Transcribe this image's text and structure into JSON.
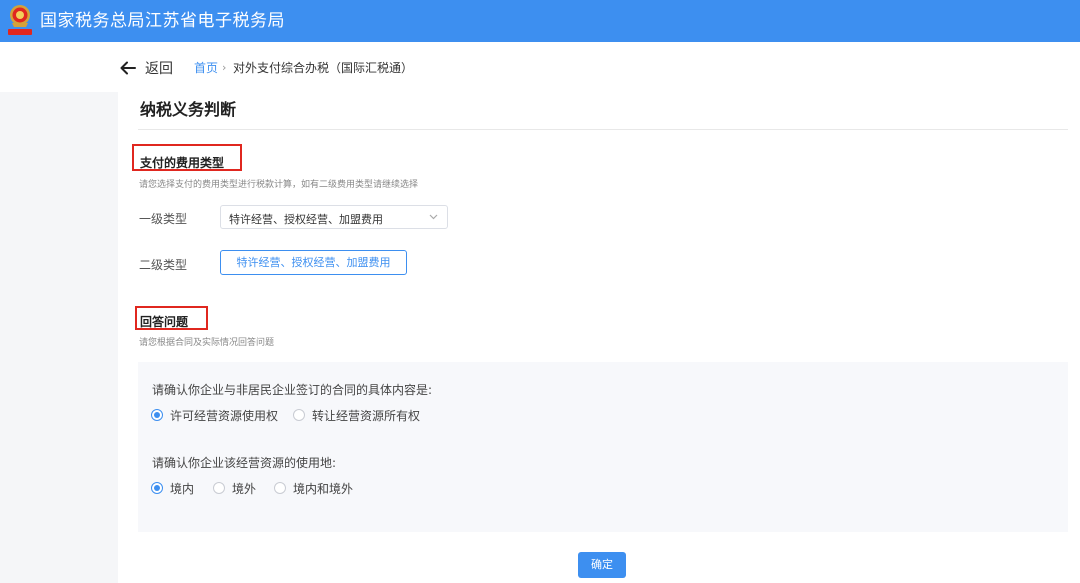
{
  "header": {
    "site_title": "国家税务总局江苏省电子税务局",
    "brand_color": "#3d8ff0"
  },
  "nav": {
    "back_label": "返回",
    "breadcrumb": {
      "home": "首页",
      "separator": "›",
      "current": "对外支付综合办税（国际汇税通）"
    }
  },
  "page": {
    "title": "纳税义务判断"
  },
  "expense_section": {
    "title": "支付的费用类型",
    "hint": "请您选择支付的费用类型进行税款计算，如有二级费用类型请继续选择",
    "level1": {
      "label": "一级类型",
      "value": "特许经营、授权经营、加盟费用"
    },
    "level2": {
      "label": "二级类型",
      "value": "特许经营、授权经营、加盟费用"
    }
  },
  "answer_section": {
    "title": "回答问题",
    "hint": "请您根据合同及实际情况回答问题",
    "q1": {
      "text": "请确认你企业与非居民企业签订的合同的具体内容是:",
      "options": [
        {
          "label": "许可经营资源使用权",
          "checked": true
        },
        {
          "label": "转让经营资源所有权",
          "checked": false
        }
      ]
    },
    "q2": {
      "text": "请确认你企业该经营资源的使用地:",
      "options": [
        {
          "label": "境内",
          "checked": true
        },
        {
          "label": "境外",
          "checked": false
        },
        {
          "label": "境内和境外",
          "checked": false
        }
      ]
    }
  },
  "footer": {
    "confirm_label": "确定"
  }
}
